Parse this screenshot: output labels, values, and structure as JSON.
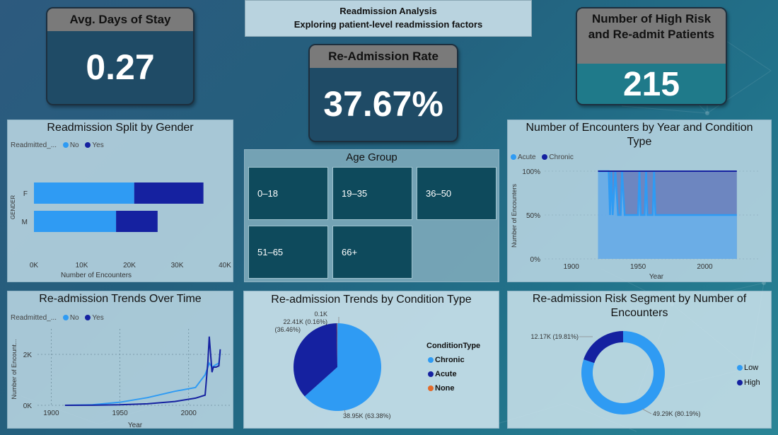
{
  "header": {
    "title": "Readmission Analysis",
    "subtitle": "Exploring patient-level readmission factors"
  },
  "kpis": {
    "avg_stay": {
      "label": "Avg. Days of Stay",
      "value": "0.27"
    },
    "readmission_rate": {
      "label": "Re-Admission Rate",
      "value": "37.67%"
    },
    "high_risk": {
      "label": "Number of High Risk and Re-admit Patients",
      "value": "215"
    }
  },
  "gender_chart": {
    "title": "Readmission Split by Gender",
    "legend_title": "Readmitted_...",
    "legend": [
      "No",
      "Yes"
    ],
    "ylabel": "GENDER",
    "xlabel": "Number of Encounters",
    "xticks": [
      "0K",
      "10K",
      "20K",
      "30K",
      "40K"
    ]
  },
  "age_group": {
    "title": "Age Group",
    "tiles": [
      "0–18",
      "19–35",
      "36–50",
      "51–65",
      "66+"
    ]
  },
  "encounters_chart": {
    "title": "Number of Encounters by Year and Condition Type",
    "legend": [
      "Acute",
      "Chronic"
    ],
    "ylabel": "Number of Encounters",
    "xlabel": "Year",
    "yticks": [
      "100%",
      "50%",
      "0%"
    ],
    "xticks": [
      "1900",
      "1950",
      "2000"
    ]
  },
  "trend_chart": {
    "title": "Re-admission Trends Over Time",
    "legend_title": "Readmitted_...",
    "legend": [
      "No",
      "Yes"
    ],
    "ylabel": "Number of Encount...",
    "xlabel": "Year",
    "yticks": [
      "2K",
      "0K"
    ],
    "xticks": [
      "1900",
      "1950",
      "2000"
    ]
  },
  "condition_pie": {
    "title": "Re-admission Trends by Condition Type",
    "legend_title": "ConditionType",
    "legend": [
      "Chronic",
      "Acute",
      "None"
    ],
    "labels": {
      "none": "0.1K",
      "acute_a": "22.41K (0.16%)",
      "acute_b": "(36.46%)",
      "chronic": "38.95K (63.38%)"
    }
  },
  "risk_donut": {
    "title": "Re-admission Risk Segment by Number of Encounters",
    "legend": [
      "Low",
      "High"
    ],
    "labels": {
      "high": "12.17K (19.81%)",
      "low": "49.29K (80.19%)"
    }
  },
  "colors": {
    "light_blue": "#2f9bf3",
    "dark_blue": "#1521a0",
    "orange": "#e36a2a",
    "kpi_header": "#7a7a7a"
  },
  "chart_data": [
    {
      "type": "bar",
      "title": "Readmission Split by Gender",
      "categories": [
        "F",
        "M"
      ],
      "series": [
        {
          "name": "No",
          "values": [
            21000,
            17200
          ]
        },
        {
          "name": "Yes",
          "values": [
            14500,
            8700
          ]
        }
      ],
      "xlabel": "Number of Encounters",
      "ylabel": "GENDER",
      "xlim": [
        0,
        40000
      ]
    },
    {
      "type": "area",
      "title": "Number of Encounters by Year and Condition Type",
      "xlim": [
        1880,
        2040
      ],
      "ylim": [
        0,
        1
      ],
      "series": [
        {
          "name": "Acute",
          "x": [
            1920,
            1928,
            1929,
            1930,
            1931,
            1933,
            1935,
            1937,
            1938,
            1940,
            1941,
            1950,
            1951,
            1952,
            1953,
            1955,
            1956,
            1957,
            1959,
            1961,
            1962,
            1963,
            1964,
            2024
          ],
          "values": [
            1,
            1,
            0.5,
            1,
            0.5,
            1,
            0.5,
            0.5,
            1,
            0.5,
            0.5,
            0.5,
            1,
            0.5,
            0.5,
            0.5,
            1,
            0.5,
            0.5,
            0.5,
            1,
            0.5,
            0.5,
            0.5
          ]
        },
        {
          "name": "Chronic",
          "x": [
            1920,
            2024
          ],
          "values": [
            1,
            1
          ]
        }
      ]
    },
    {
      "type": "line",
      "title": "Re-admission Trends Over Time",
      "xlim": [
        1890,
        2030
      ],
      "ylim": [
        0,
        3000
      ],
      "series": [
        {
          "name": "No",
          "x": [
            1910,
            1930,
            1950,
            1970,
            1990,
            2005,
            2012,
            2015,
            2017,
            2020,
            2022,
            2023
          ],
          "values": [
            0,
            20,
            120,
            300,
            550,
            700,
            1200,
            1650,
            1500,
            1600,
            1650,
            2100
          ]
        },
        {
          "name": "Yes",
          "x": [
            1910,
            1930,
            1950,
            1970,
            1990,
            2005,
            2012,
            2014,
            2015,
            2017,
            2018,
            2020,
            2022,
            2023
          ],
          "values": [
            0,
            5,
            20,
            60,
            150,
            280,
            400,
            1700,
            2700,
            1300,
            1500,
            1500,
            1550,
            2200
          ]
        }
      ]
    },
    {
      "type": "pie",
      "title": "Re-admission Trends by Condition Type",
      "categories": [
        "Chronic",
        "Acute",
        "None"
      ],
      "values": [
        38950,
        22410,
        100
      ]
    },
    {
      "type": "pie",
      "title": "Re-admission Risk Segment by Number of Encounters",
      "categories": [
        "Low",
        "High"
      ],
      "values": [
        49290,
        12170
      ]
    }
  ]
}
